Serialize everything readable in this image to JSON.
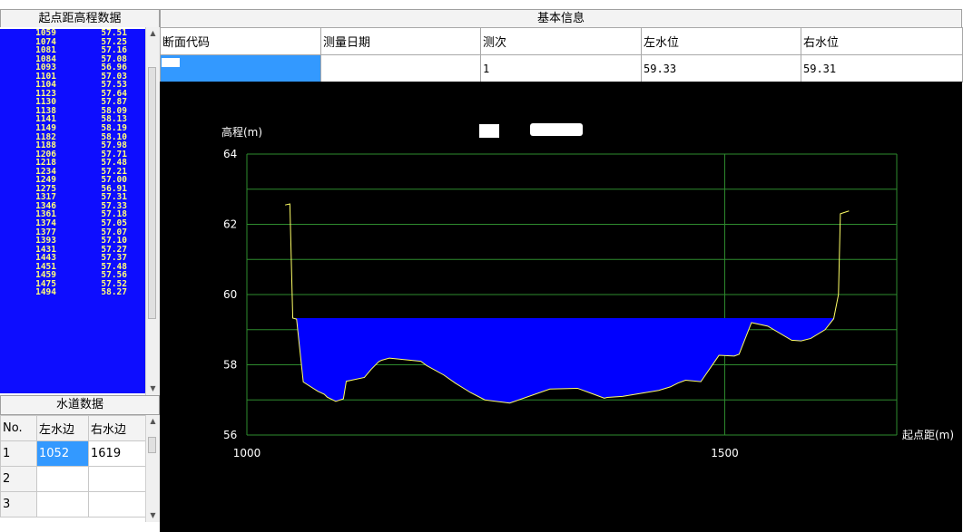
{
  "elevation_panel": {
    "title": "起点距高程数据",
    "rows": [
      {
        "d": "1059",
        "e": "57.51"
      },
      {
        "d": "1074",
        "e": "57.25"
      },
      {
        "d": "1081",
        "e": "57.16"
      },
      {
        "d": "1084",
        "e": "57.08"
      },
      {
        "d": "1093",
        "e": "56.96"
      },
      {
        "d": "1101",
        "e": "57.03"
      },
      {
        "d": "1104",
        "e": "57.53"
      },
      {
        "d": "1123",
        "e": "57.64"
      },
      {
        "d": "1130",
        "e": "57.87"
      },
      {
        "d": "1138",
        "e": "58.09"
      },
      {
        "d": "1141",
        "e": "58.13"
      },
      {
        "d": "1149",
        "e": "58.19"
      },
      {
        "d": "1182",
        "e": "58.10"
      },
      {
        "d": "1188",
        "e": "57.98"
      },
      {
        "d": "1206",
        "e": "57.71"
      },
      {
        "d": "1218",
        "e": "57.48"
      },
      {
        "d": "1234",
        "e": "57.21"
      },
      {
        "d": "1249",
        "e": "57.00"
      },
      {
        "d": "1275",
        "e": "56.91"
      },
      {
        "d": "1317",
        "e": "57.31"
      },
      {
        "d": "1346",
        "e": "57.33"
      },
      {
        "d": "1361",
        "e": "57.18"
      },
      {
        "d": "1374",
        "e": "57.05"
      },
      {
        "d": "1377",
        "e": "57.07"
      },
      {
        "d": "1393",
        "e": "57.10"
      },
      {
        "d": "1431",
        "e": "57.27"
      },
      {
        "d": "1443",
        "e": "57.37"
      },
      {
        "d": "1451",
        "e": "57.48"
      },
      {
        "d": "1459",
        "e": "57.56"
      },
      {
        "d": "1475",
        "e": "57.52"
      },
      {
        "d": "1494",
        "e": "58.27"
      }
    ]
  },
  "info": {
    "title": "基本信息",
    "headers": [
      "断面代码",
      "测量日期",
      "测次",
      "左水位",
      "右水位"
    ],
    "values": [
      "",
      "",
      "1",
      "59.33",
      "59.31"
    ]
  },
  "waterline": {
    "title": "水道数据",
    "headers": [
      "No.",
      "左水边",
      "右水边"
    ],
    "rows": [
      {
        "no": "1",
        "left": "1052",
        "right": "1619"
      },
      {
        "no": "2",
        "left": "",
        "right": ""
      },
      {
        "no": "3",
        "left": "",
        "right": ""
      }
    ]
  },
  "chart_data": {
    "type": "area",
    "ylabel": "高程(m)",
    "xlabel": "起点距(m)",
    "xlim": [
      1000,
      1680
    ],
    "ylim": [
      56,
      64
    ],
    "x_ticks": [
      "1000",
      "1500"
    ],
    "y_ticks": [
      "64",
      "62",
      "60",
      "58",
      "56"
    ],
    "grid": true,
    "water_level": 59.33,
    "colors": {
      "background": "#000000",
      "grid": "#2e8b2e",
      "profile": "#ffff66",
      "water": "#0000ff"
    },
    "profile": [
      [
        1040,
        62.55
      ],
      [
        1045,
        62.58
      ],
      [
        1048,
        59.33
      ],
      [
        1052,
        59.3
      ],
      [
        1059,
        57.51
      ],
      [
        1074,
        57.25
      ],
      [
        1081,
        57.16
      ],
      [
        1084,
        57.08
      ],
      [
        1093,
        56.96
      ],
      [
        1101,
        57.03
      ],
      [
        1104,
        57.53
      ],
      [
        1123,
        57.64
      ],
      [
        1130,
        57.87
      ],
      [
        1138,
        58.09
      ],
      [
        1141,
        58.13
      ],
      [
        1149,
        58.19
      ],
      [
        1182,
        58.1
      ],
      [
        1188,
        57.98
      ],
      [
        1206,
        57.71
      ],
      [
        1218,
        57.48
      ],
      [
        1234,
        57.21
      ],
      [
        1249,
        57.0
      ],
      [
        1275,
        56.91
      ],
      [
        1317,
        57.31
      ],
      [
        1346,
        57.33
      ],
      [
        1361,
        57.18
      ],
      [
        1374,
        57.05
      ],
      [
        1377,
        57.07
      ],
      [
        1393,
        57.1
      ],
      [
        1431,
        57.27
      ],
      [
        1443,
        57.37
      ],
      [
        1451,
        57.48
      ],
      [
        1459,
        57.56
      ],
      [
        1475,
        57.52
      ],
      [
        1494,
        58.27
      ],
      [
        1510,
        58.25
      ],
      [
        1515,
        58.3
      ],
      [
        1528,
        59.2
      ],
      [
        1545,
        59.1
      ],
      [
        1570,
        58.7
      ],
      [
        1580,
        58.68
      ],
      [
        1590,
        58.75
      ],
      [
        1605,
        59.0
      ],
      [
        1614,
        59.31
      ],
      [
        1619,
        60.0
      ],
      [
        1621,
        62.3
      ],
      [
        1630,
        62.38
      ]
    ]
  }
}
